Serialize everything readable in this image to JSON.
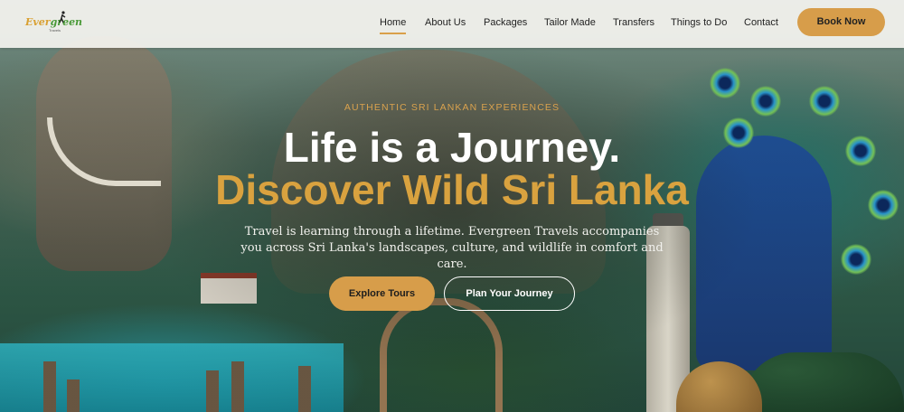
{
  "brand": {
    "logo_text_prefix": "Ever",
    "logo_text_suffix": "green",
    "logo_sub": "Travels",
    "accent_color": "#d79d4a",
    "green_color": "#4a9a38"
  },
  "nav": {
    "items": [
      {
        "label": "Home",
        "active": true
      },
      {
        "label": "About Us",
        "active": false
      },
      {
        "label": "Packages",
        "active": false
      },
      {
        "label": "Tailor Made",
        "active": false
      },
      {
        "label": "Transfers",
        "active": false
      },
      {
        "label": "Things to Do",
        "active": false
      },
      {
        "label": "Contact",
        "active": false
      }
    ],
    "cta_label": "Book Now"
  },
  "hero": {
    "eyebrow": "AUTHENTIC SRI LANKAN EXPERIENCES",
    "headline_line1": "Life is a Journey.",
    "headline_line2": "Discover Wild Sri Lanka",
    "description": "Travel is learning through a lifetime. Evergreen Travels accompanies you across Sri Lanka's landscapes, culture, and wildlife in comfort and care.",
    "primary_button": "Explore Tours",
    "secondary_button": "Plan Your Journey"
  }
}
